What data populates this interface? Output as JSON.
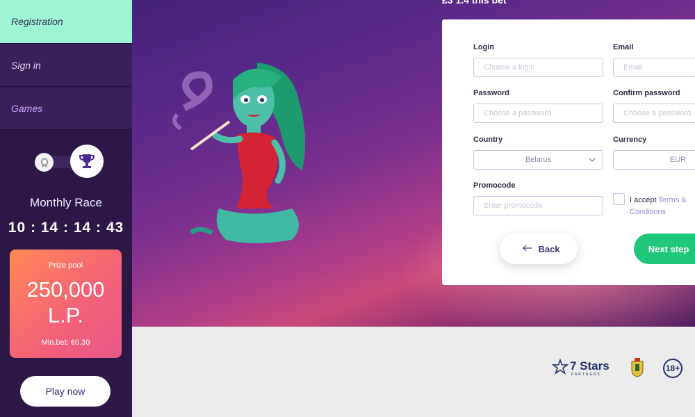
{
  "sidebar": {
    "nav": [
      {
        "label": "Registration"
      },
      {
        "label": "Sign in"
      },
      {
        "label": "Games"
      }
    ],
    "race": {
      "title": "Monthly Race",
      "timer": "10 : 14 : 14 : 43"
    },
    "prize": {
      "label": "Prize pool",
      "value": "250,000 L.P.",
      "min_bet": "Min.bet: €0.30"
    },
    "play_button": "Play now"
  },
  "hero": {
    "top_text": "£3 1.4 this bet"
  },
  "form": {
    "login": {
      "label": "Login",
      "placeholder": "Choose a login"
    },
    "email": {
      "label": "Email",
      "placeholder": "Email"
    },
    "password": {
      "label": "Password",
      "placeholder": "Choose a password"
    },
    "confirm": {
      "label": "Confirm password",
      "placeholder": "Choose a password"
    },
    "country": {
      "label": "Country",
      "value": "Belarus"
    },
    "currency": {
      "label": "Currency",
      "value": "EUR"
    },
    "promocode": {
      "label": "Promocode",
      "placeholder": "Enter promocode"
    },
    "terms": {
      "prefix": "I accept ",
      "link": "Terms & Conditions"
    },
    "back_button": "Back",
    "next_button": "Next step"
  },
  "footer": {
    "partner_name": "7 Stars",
    "partner_sub": "PARTNERS",
    "age_badge": "18+"
  },
  "colors": {
    "sidebar_bg": "#2c1746",
    "active_nav": "#9ef5d4",
    "next_button": "#1fc77b",
    "prize_card": "#f36078"
  }
}
